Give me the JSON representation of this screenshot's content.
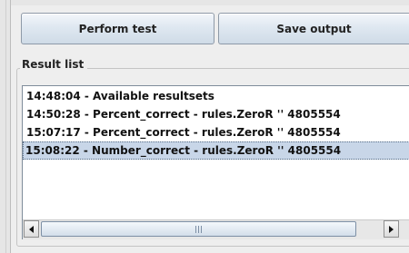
{
  "buttons": {
    "perform_test": "Perform test",
    "save_output": "Save output"
  },
  "result_list": {
    "title": "Result list",
    "items": [
      {
        "text": "14:48:04 - Available resultsets",
        "selected": false
      },
      {
        "text": "14:50:28 - Percent_correct - rules.ZeroR '' 4805554",
        "selected": false
      },
      {
        "text": "15:07:17 - Percent_correct - rules.ZeroR '' 4805554",
        "selected": false
      },
      {
        "text": "15:08:22 - Number_correct - rules.ZeroR '' 4805554",
        "selected": true
      }
    ]
  },
  "scrollbar": {
    "icons": {
      "left": "arrow-left-icon",
      "right": "arrow-right-icon",
      "grip": "grip-icon"
    }
  },
  "colors": {
    "selection": "#c8d6e8",
    "button_gradient_top": "#f3f7fb",
    "button_gradient_bottom": "#cfdbe7"
  }
}
